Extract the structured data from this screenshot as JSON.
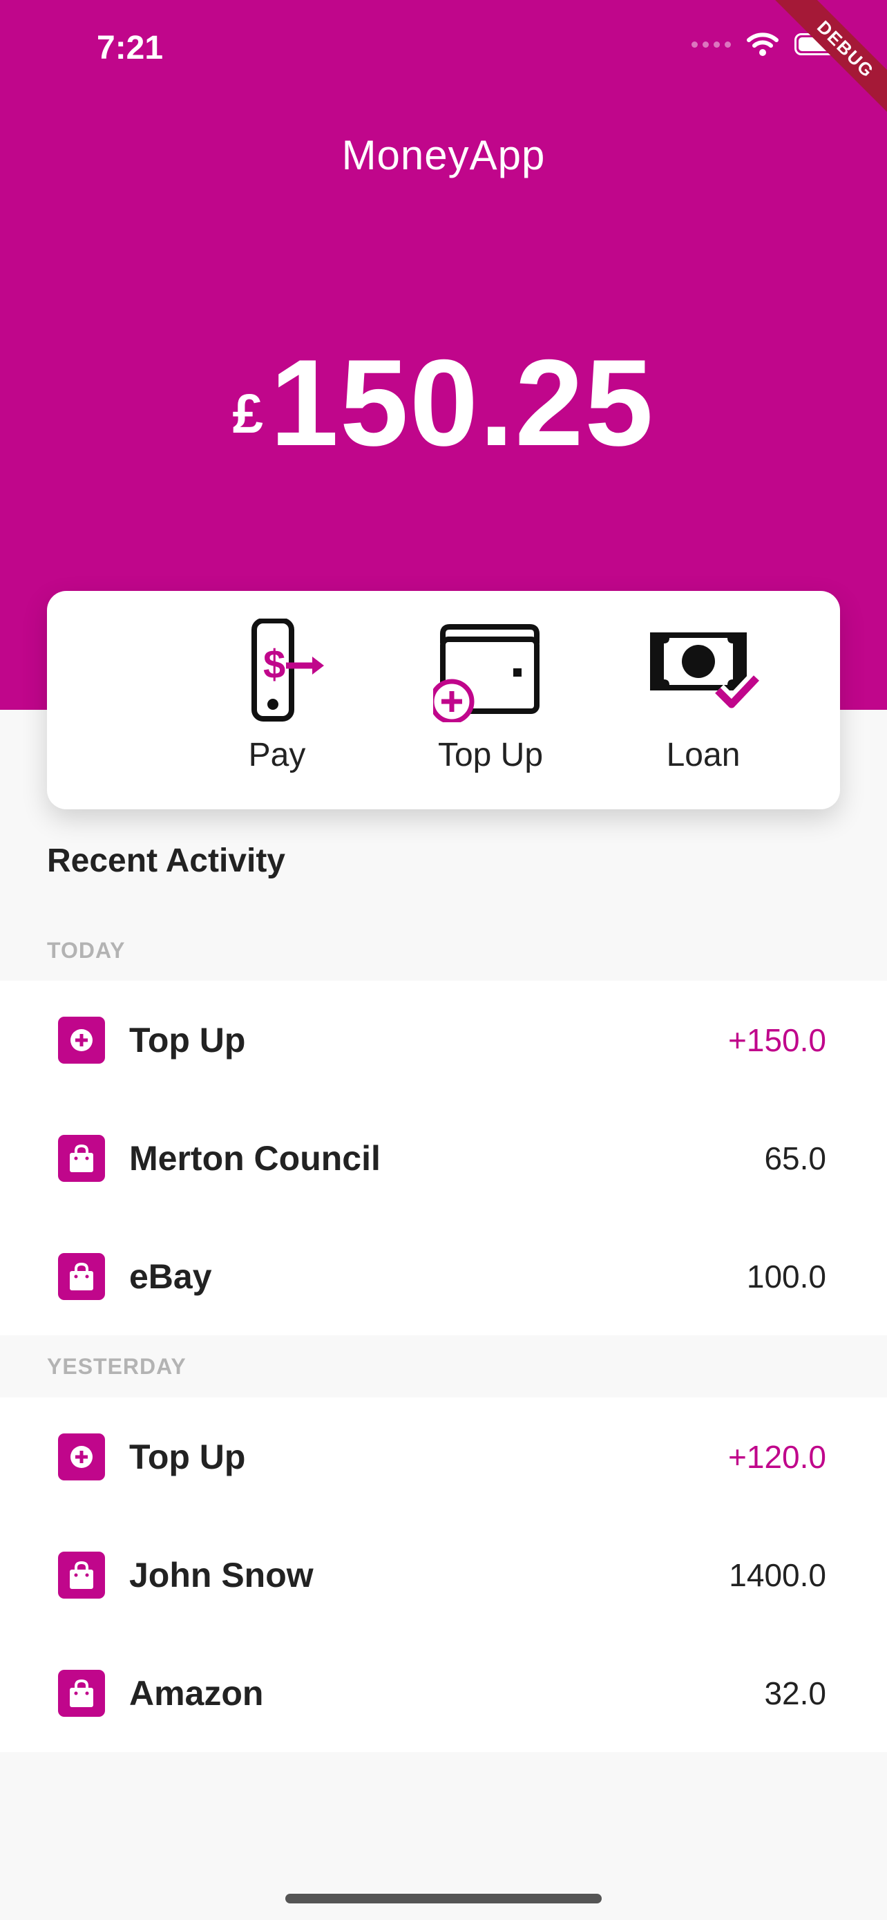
{
  "status_bar": {
    "time": "7:21",
    "debug_label": "DEBUG"
  },
  "app": {
    "title": "MoneyApp"
  },
  "balance": {
    "currency": "£",
    "amount": "150.25"
  },
  "actions": [
    {
      "label": "Pay",
      "icon": "phone-pay-icon"
    },
    {
      "label": "Top Up",
      "icon": "wallet-add-icon"
    },
    {
      "label": "Loan",
      "icon": "cash-check-icon"
    }
  ],
  "recent": {
    "title": "Recent Activity",
    "groups": [
      {
        "label": "TODAY",
        "items": [
          {
            "name": "Top Up",
            "amount": "+150.0",
            "icon": "plus-circle-icon",
            "positive": true
          },
          {
            "name": "Merton Council",
            "amount": "65.0",
            "icon": "shopping-bag-icon",
            "positive": false
          },
          {
            "name": "eBay",
            "amount": "100.0",
            "icon": "shopping-bag-icon",
            "positive": false
          }
        ]
      },
      {
        "label": "YESTERDAY",
        "items": [
          {
            "name": "Top Up",
            "amount": "+120.0",
            "icon": "plus-circle-icon",
            "positive": true
          },
          {
            "name": "John Snow",
            "amount": "1400.0",
            "icon": "shopping-bag-icon",
            "positive": false
          },
          {
            "name": "Amazon",
            "amount": "32.0",
            "icon": "shopping-bag-icon",
            "positive": false
          }
        ]
      }
    ]
  },
  "colors": {
    "brand": "#c0068b",
    "text": "#222222",
    "muted": "#b3b3b3",
    "background": "#f8f8f8"
  }
}
